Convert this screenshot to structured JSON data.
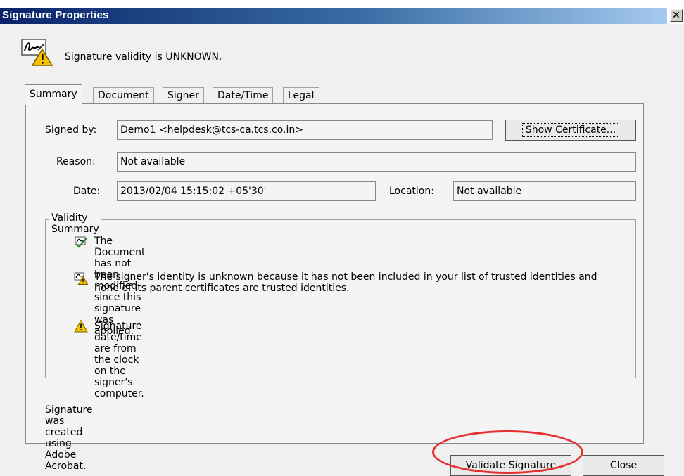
{
  "window": {
    "title": "Signature Properties",
    "close_glyph": "✕"
  },
  "header": {
    "status_text": "Signature validity is UNKNOWN.",
    "icon": "signature-warning-icon"
  },
  "tabs": [
    {
      "label": "Summary",
      "active": true
    },
    {
      "label": "Document",
      "active": false
    },
    {
      "label": "Signer",
      "active": false
    },
    {
      "label": "Date/Time",
      "active": false
    },
    {
      "label": "Legal",
      "active": false
    }
  ],
  "summary": {
    "signed_by_label": "Signed by:",
    "signed_by_value": "Demo1 <helpdesk@tcs-ca.tcs.co.in>",
    "show_certificate_label": "Show Certificate...",
    "reason_label": "Reason:",
    "reason_value": "Not available",
    "date_label": "Date:",
    "date_value": "2013/02/04 15:15:02 +05'30'",
    "location_label": "Location:",
    "location_value": "Not available"
  },
  "validity_summary": {
    "title": "Validity Summary",
    "items": [
      {
        "icon": "document-check-icon",
        "text": "The Document has not been modified since this signature was applied."
      },
      {
        "icon": "signer-warning-icon",
        "text": "The signer's identity is unknown because it has not been included in your list of trusted identities and none of its parent certificates are trusted identities."
      },
      {
        "icon": "warning-triangle-icon",
        "text": "Signature date/time are from the clock on the signer's computer."
      }
    ]
  },
  "footer_text": "Signature was created using Adobe Acrobat.",
  "buttons": {
    "validate_label": "Validate Signature",
    "close_label": "Close"
  },
  "colors": {
    "title_bar_start": "#0a246a",
    "title_bar_end": "#a6caf0",
    "annotation_ellipse": "#e53030",
    "warning_yellow": "#f5c400"
  }
}
